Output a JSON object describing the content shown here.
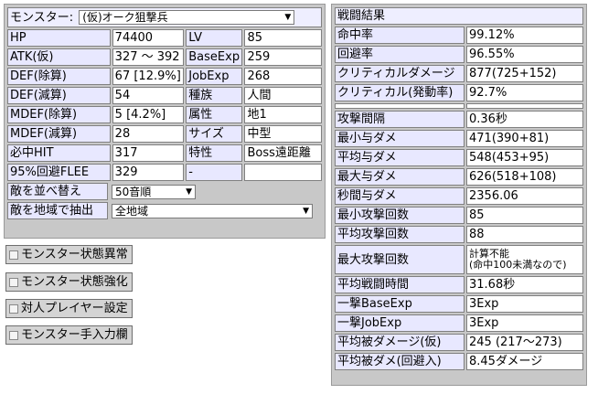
{
  "monster": {
    "label": "モンスター:",
    "selected": "(仮)オーク狙撃兵",
    "rows": [
      [
        "HP",
        "74400",
        "LV",
        "85"
      ],
      [
        "ATK(仮)",
        "327 〜 392",
        "BaseExp",
        "259"
      ],
      [
        "DEF(除算)",
        "67 [12.9%]",
        "JobExp",
        "268"
      ],
      [
        "DEF(減算)",
        "54",
        "種族",
        "人間"
      ],
      [
        "MDEF(除算)",
        "5 [4.2%]",
        "属性",
        "地1"
      ],
      [
        "MDEF(減算)",
        "28",
        "サイズ",
        "中型"
      ],
      [
        "必中HIT",
        "317",
        "特性",
        "Boss遠距離"
      ],
      [
        "95%回避FLEE",
        "329",
        "-",
        ""
      ]
    ],
    "sort_label": "敵を並べ替え",
    "sort_value": "50音順",
    "filter_label": "敵を地域で抽出",
    "filter_value": "全地域"
  },
  "buttons": [
    "モンスター状態異常",
    "モンスター状態強化",
    "対人プレイヤー設定",
    "モンスター手入力欄"
  ],
  "battle": {
    "title": "戦闘結果",
    "rows_top": [
      [
        "命中率",
        "99.12%"
      ],
      [
        "回避率",
        "96.55%"
      ],
      [
        "クリティカルダメージ",
        "877(725+152)"
      ],
      [
        "クリティカル(発動率)",
        "92.7%"
      ]
    ],
    "rows_main": [
      [
        "攻撃間隔",
        "0.36秒"
      ],
      [
        "最小与ダメ",
        "471(390+81)"
      ],
      [
        "平均与ダメ",
        "548(453+95)"
      ],
      [
        "最大与ダメ",
        "626(518+108)"
      ],
      [
        "秒間与ダメ",
        "2356.06"
      ],
      [
        "最小攻撃回数",
        "85"
      ],
      [
        "平均攻撃回数",
        "88"
      ]
    ],
    "max_attack_label": "最大攻撃回数",
    "max_attack_value1": "計算不能",
    "max_attack_value2": "(命中100未満なので)",
    "rows_bottom": [
      [
        "平均戦闘時間",
        "31.68秒"
      ],
      [
        "一撃BaseExp",
        "3Exp"
      ],
      [
        "一撃JobExp",
        "3Exp"
      ],
      [
        "平均被ダメージ(仮)",
        "245 (217〜273)"
      ],
      [
        "平均被ダメ(回避入)",
        "8.45ダメージ"
      ]
    ]
  }
}
